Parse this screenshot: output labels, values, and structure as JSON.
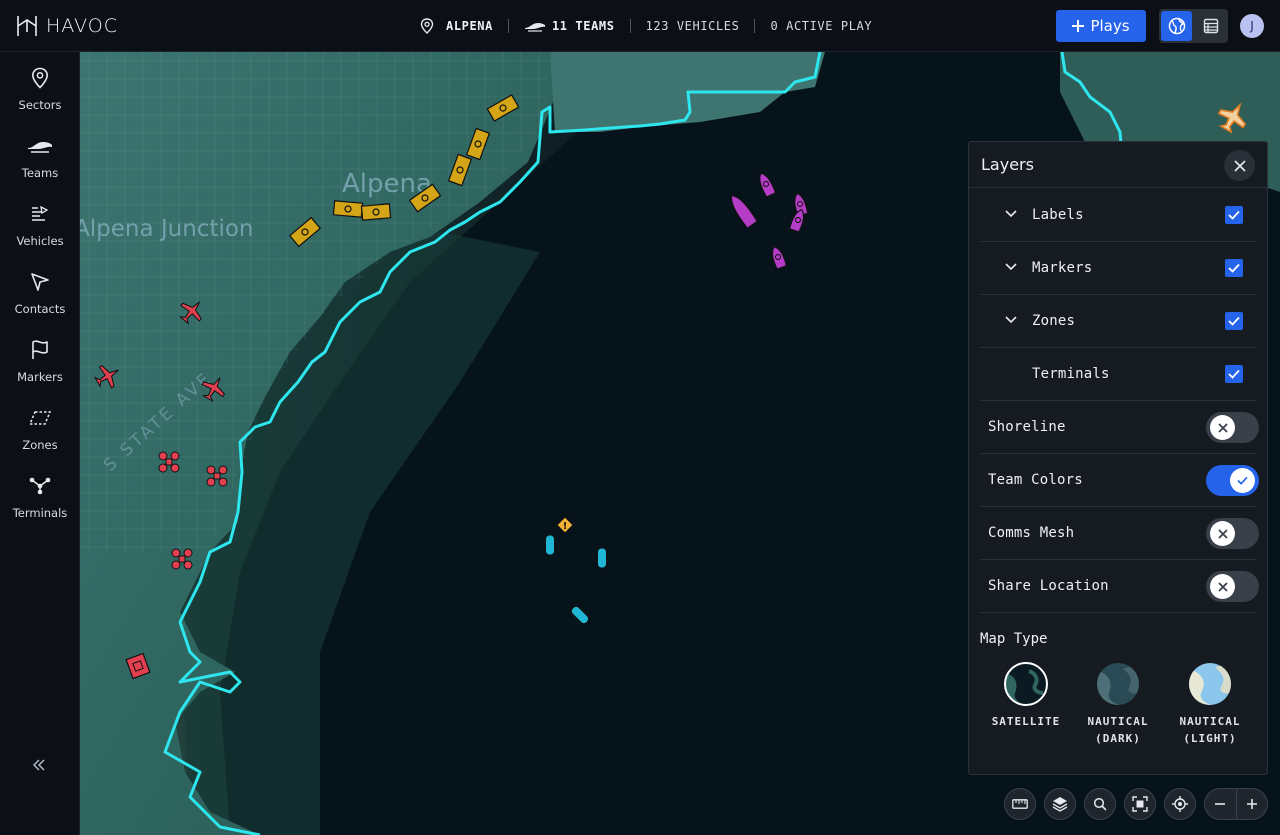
{
  "app": {
    "logo_text": "HAVOC"
  },
  "header": {
    "location": "ALPENA",
    "teams": "11 TEAMS",
    "vehicles": "123 VEHICLES",
    "active_play": "0 ACTIVE PLAY",
    "plays_label": "Plays",
    "user_initial": "J"
  },
  "sidebar": {
    "items": [
      {
        "label": "Sectors",
        "icon": "pin-icon"
      },
      {
        "label": "Teams",
        "icon": "teams-icon"
      },
      {
        "label": "Vehicles",
        "icon": "vehicles-icon"
      },
      {
        "label": "Contacts",
        "icon": "cursor-icon"
      },
      {
        "label": "Markers",
        "icon": "flag-icon"
      },
      {
        "label": "Zones",
        "icon": "zone-icon"
      },
      {
        "label": "Terminals",
        "icon": "network-icon"
      }
    ]
  },
  "map": {
    "labels": [
      "Alpena",
      "Alpena Junction",
      "S STATE AVE"
    ]
  },
  "layers": {
    "title": "Layers",
    "groups": [
      {
        "label": "Labels",
        "checked": true
      },
      {
        "label": "Markers",
        "checked": true
      },
      {
        "label": "Zones",
        "checked": true
      },
      {
        "label": "Terminals",
        "checked": true
      }
    ],
    "toggles": [
      {
        "label": "Shoreline",
        "on": false
      },
      {
        "label": "Team Colors",
        "on": true
      },
      {
        "label": "Comms Mesh",
        "on": false
      },
      {
        "label": "Share Location",
        "on": false
      }
    ],
    "map_type_title": "Map Type",
    "map_types": [
      {
        "line1": "SATELLITE",
        "line2": "",
        "selected": true
      },
      {
        "line1": "NAUTICAL",
        "line2": "(DARK)",
        "selected": false
      },
      {
        "line1": "NAUTICAL",
        "line2": "(LIGHT)",
        "selected": false
      }
    ]
  },
  "colors": {
    "accent": "#2563eb",
    "shoreline": "#2ee6ee",
    "team_yellow": "#d4a516",
    "team_magenta": "#b43cc6",
    "team_red": "#e0404f",
    "team_cyan": "#1fb6d6"
  }
}
